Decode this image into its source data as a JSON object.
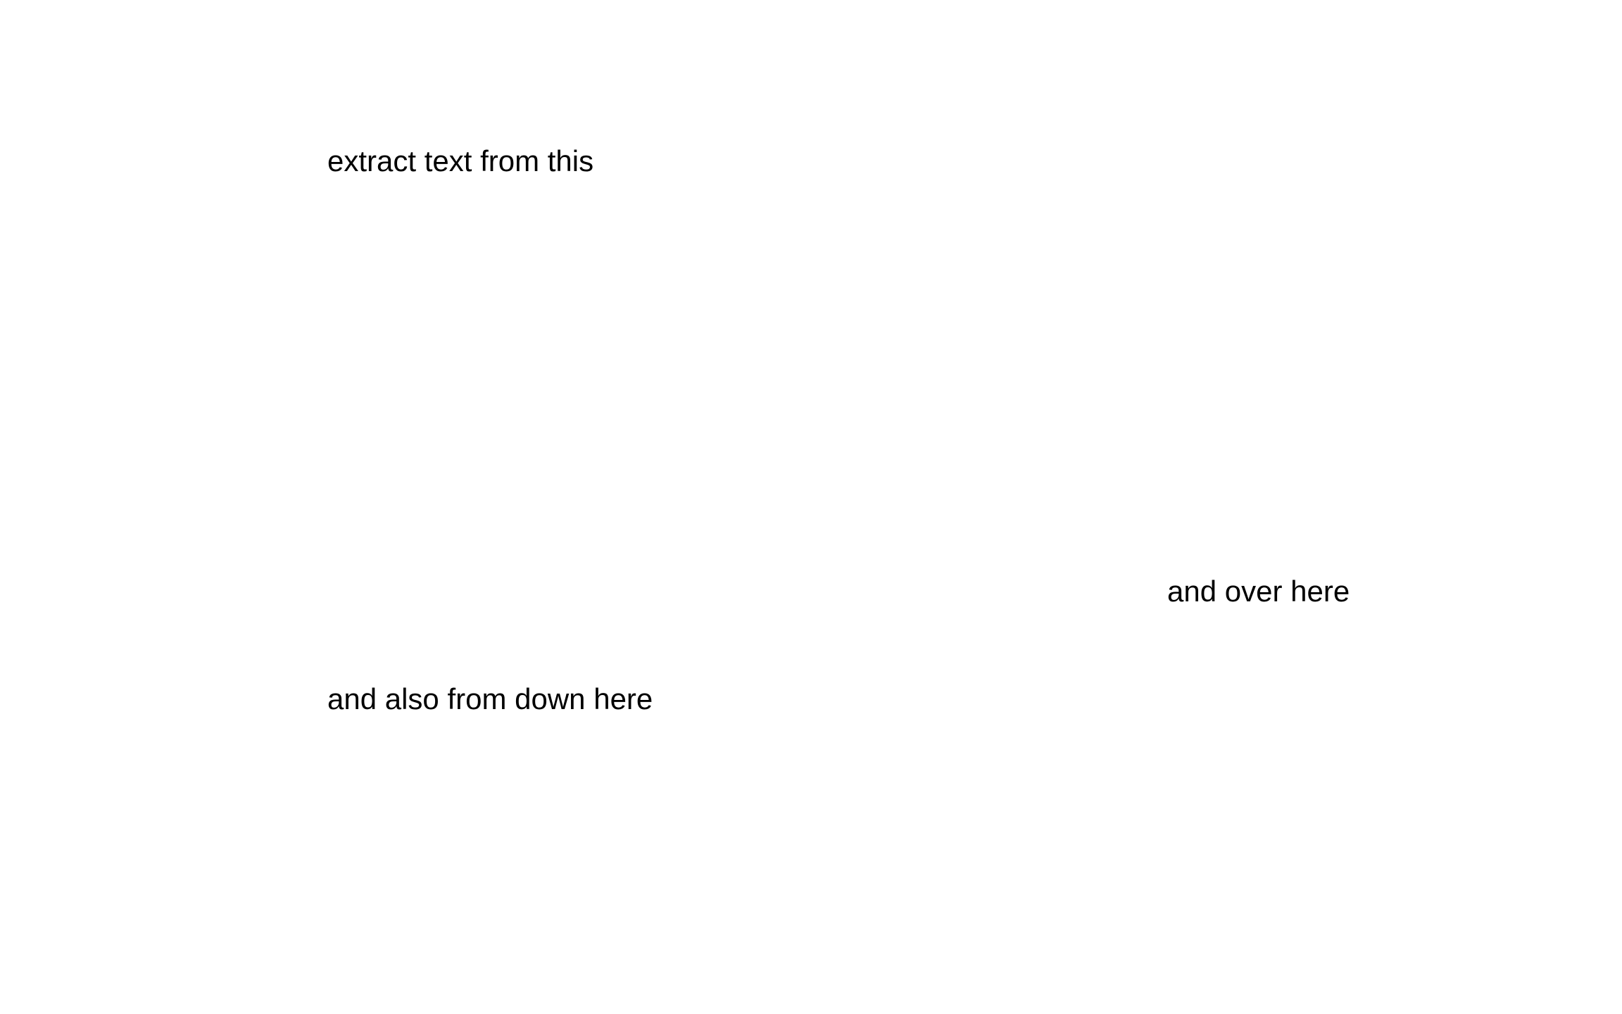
{
  "document": {
    "lines": [
      "extract text from this",
      "and over here",
      "and also from down here"
    ]
  }
}
